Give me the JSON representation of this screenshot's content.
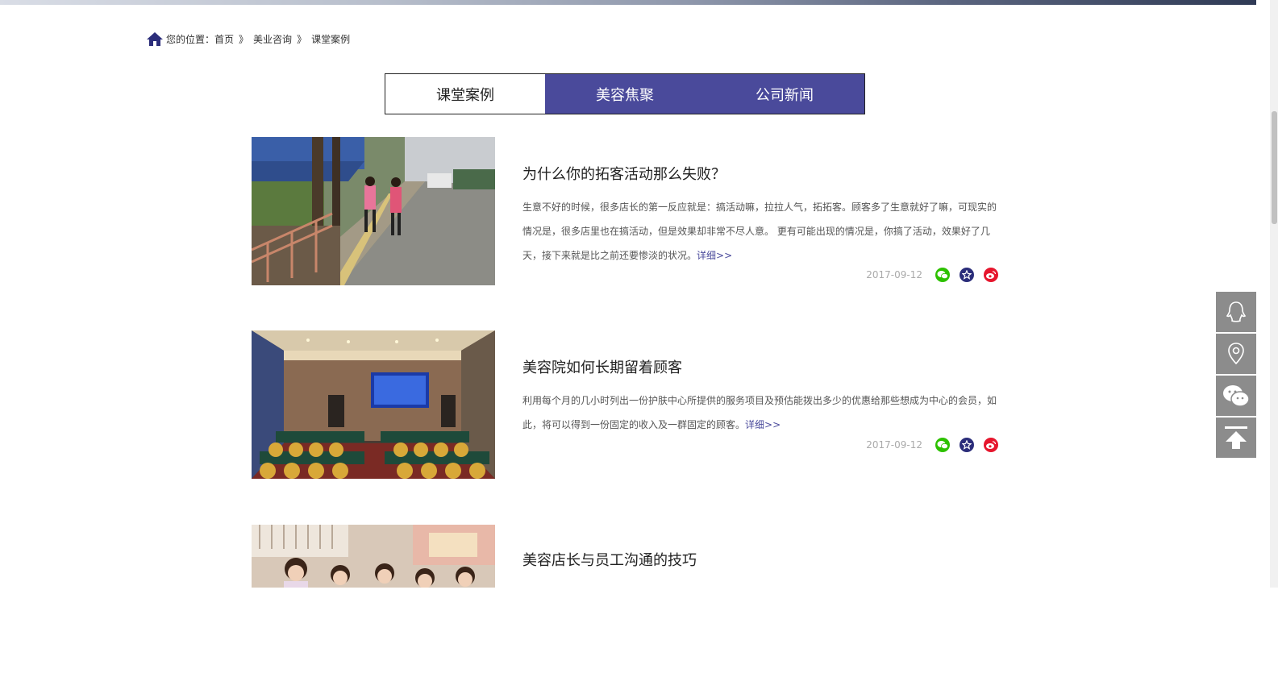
{
  "breadcrumb": {
    "prefix": "您的位置：",
    "items": [
      "首页",
      "美业咨询",
      "课堂案例"
    ],
    "separator": "》"
  },
  "tabs": [
    {
      "label": "课堂案例",
      "active": true
    },
    {
      "label": "美容焦聚",
      "active": false
    },
    {
      "label": "公司新闻",
      "active": false
    }
  ],
  "articles": [
    {
      "title": "为什么你的拓客活动那么失败？",
      "summary": "生意不好的时候，很多店长的第一反应就是：搞活动嘛，拉拉人气，拓拓客。顾客多了生意就好了嘛，可现实的情况是，很多店里也在搞活动，但是效果却非常不尽人意。 更有可能出现的情况是，你搞了活动，效果好了几天，接下来就是比之前还要惨淡的状况。",
      "more": "详细>>",
      "date": "2017-09-12"
    },
    {
      "title": "美容院如何长期留着顾客",
      "summary": "利用每个月的几小时列出一份护肤中心所提供的服务项目及预估能拨出多少的优惠给那些想成为中心的会员，如此，将可以得到一份固定的收入及一群固定的顾客。",
      "more": "详细>>",
      "date": "2017-09-12"
    },
    {
      "title": "美容店长与员工沟通的技巧"
    }
  ],
  "share_icons": [
    "wechat-icon",
    "qzone-star-icon",
    "weibo-icon"
  ],
  "side_tools": [
    "qq-icon",
    "location-pin-icon",
    "wechat-icon",
    "back-to-top-icon"
  ],
  "colors": {
    "accent": "#4a4a9b",
    "wechat": "#2dc100",
    "qzone": "#2b2d7a",
    "weibo": "#e6162d",
    "side_tool_bg": "#8c8c8c"
  }
}
